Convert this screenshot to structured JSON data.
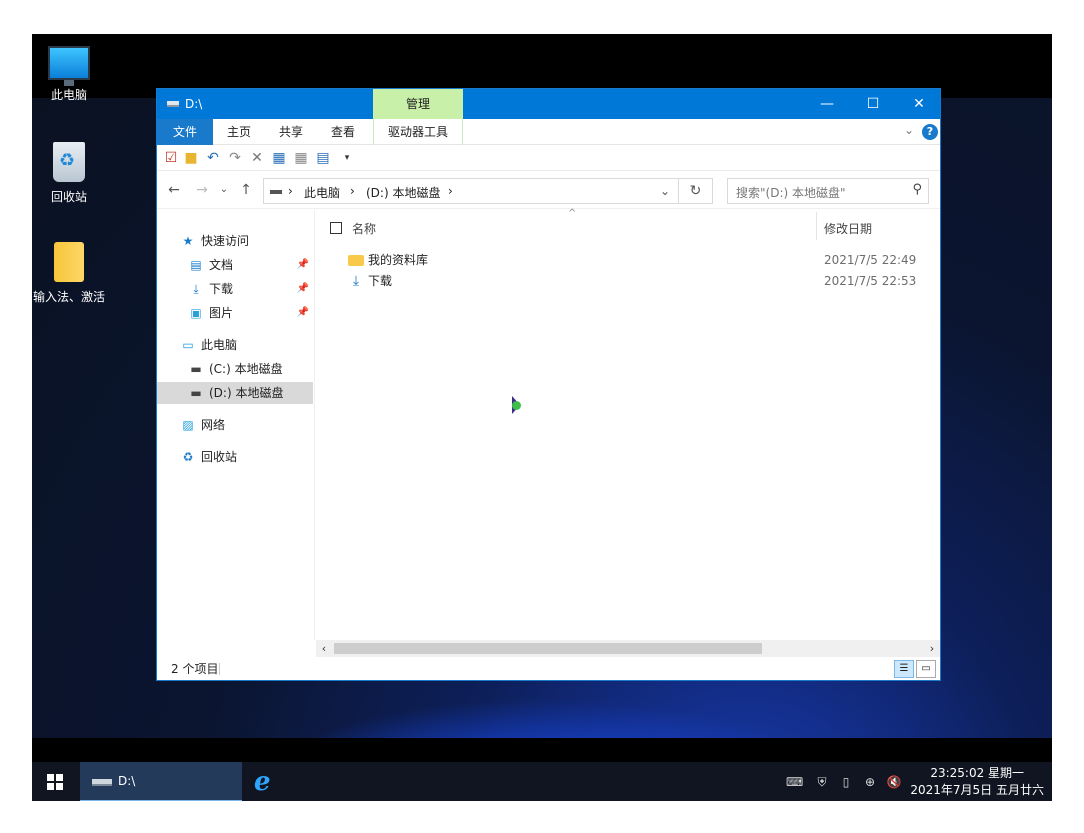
{
  "desktop": {
    "icons": [
      {
        "label": "此电脑"
      },
      {
        "label": "回收站"
      },
      {
        "label": "输入法、激活"
      }
    ]
  },
  "window": {
    "title": "D:\\",
    "context_tab_group": "管理",
    "controls": {
      "minimize": "—",
      "maximize": "☐",
      "close": "✕"
    }
  },
  "ribbon": {
    "tabs": [
      {
        "label": "文件"
      },
      {
        "label": "主页"
      },
      {
        "label": "共享"
      },
      {
        "label": "查看"
      },
      {
        "label": "驱动器工具"
      }
    ],
    "help": "?"
  },
  "address": {
    "crumbs": [
      "此电脑",
      "(D:) 本地磁盘"
    ],
    "search_placeholder": "搜索\"(D:) 本地磁盘\""
  },
  "navpane": {
    "quick_access": "快速访问",
    "quick_items": [
      {
        "label": "文档"
      },
      {
        "label": "下载"
      },
      {
        "label": "图片"
      }
    ],
    "this_pc": "此电脑",
    "drives": [
      {
        "label": "(C:) 本地磁盘"
      },
      {
        "label": "(D:) 本地磁盘"
      }
    ],
    "network": "网络",
    "recycle": "回收站"
  },
  "content": {
    "columns": {
      "name": "名称",
      "modified": "修改日期"
    },
    "rows": [
      {
        "name": "我的资料库",
        "modified": "2021/7/5 22:49",
        "icon": "folder-icon"
      },
      {
        "name": "下载",
        "modified": "2021/7/5 22:53",
        "icon": "download-icon"
      }
    ]
  },
  "status": {
    "item_count": "2 个项目"
  },
  "taskbar": {
    "app_label": "D:\\",
    "ie_glyph": "e",
    "time": "23:25:02 星期一",
    "date": "2021年7月5日 五月廿六"
  },
  "colors": {
    "accent": "#0078d7",
    "context_tab": "#c9f0a8",
    "taskbar": "#101521"
  }
}
